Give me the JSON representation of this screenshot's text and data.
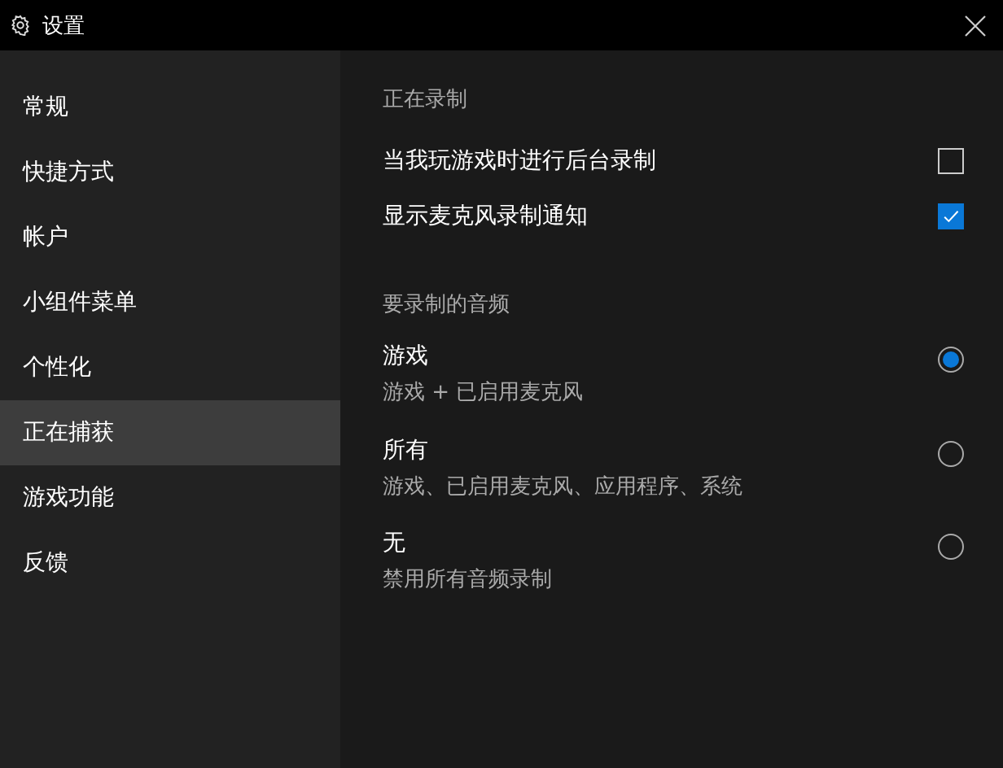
{
  "window": {
    "title": "设置"
  },
  "sidebar": {
    "items": [
      {
        "label": "常规",
        "selected": false
      },
      {
        "label": "快捷方式",
        "selected": false
      },
      {
        "label": "帐户",
        "selected": false
      },
      {
        "label": "小组件菜单",
        "selected": false
      },
      {
        "label": "个性化",
        "selected": false
      },
      {
        "label": "正在捕获",
        "selected": true
      },
      {
        "label": "游戏功能",
        "selected": false
      },
      {
        "label": "反馈",
        "selected": false
      }
    ]
  },
  "recording": {
    "heading": "正在录制",
    "options": [
      {
        "label": "当我玩游戏时进行后台录制",
        "checked": false
      },
      {
        "label": "显示麦克风录制通知",
        "checked": true
      }
    ]
  },
  "audio": {
    "heading": "要录制的音频",
    "options": [
      {
        "label": "游戏",
        "description": "游戏 + 已启用麦克风",
        "selected": true
      },
      {
        "label": "所有",
        "description": "游戏、已启用麦克风、应用程序、系统",
        "selected": false
      },
      {
        "label": "无",
        "description": "禁用所有音频录制",
        "selected": false
      }
    ]
  }
}
